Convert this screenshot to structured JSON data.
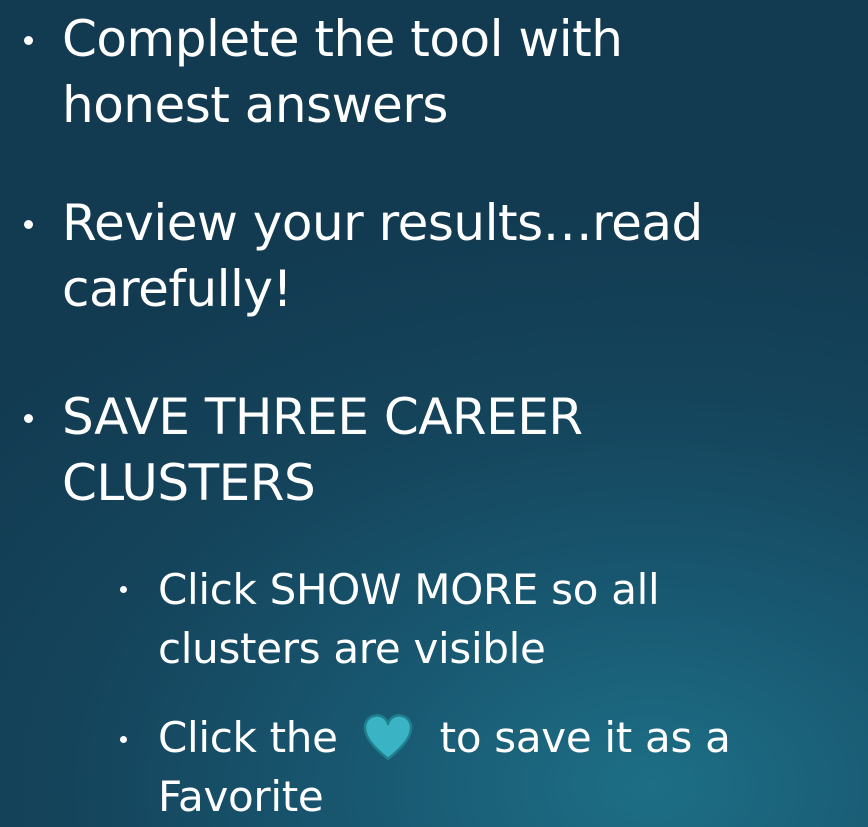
{
  "bullets": {
    "b1": {
      "line1": "Complete the tool with",
      "line2": "honest answers"
    },
    "b2": {
      "line1": "Review your results…read",
      "line2": "carefully!"
    },
    "b3": {
      "line1": "SAVE THREE CAREER",
      "line2": "CLUSTERS"
    },
    "sub1": {
      "line1": "Click SHOW MORE so all",
      "line2": "clusters are visible"
    },
    "sub2": {
      "before_icon": "Click the",
      "after_icon": "to save it as a",
      "line2": "Favorite"
    }
  },
  "icons": {
    "favorite": "heart-icon"
  },
  "colors": {
    "heart_fill": "#3ab3c4",
    "heart_outline": "#1f7f8f",
    "text": "#ffffff"
  }
}
